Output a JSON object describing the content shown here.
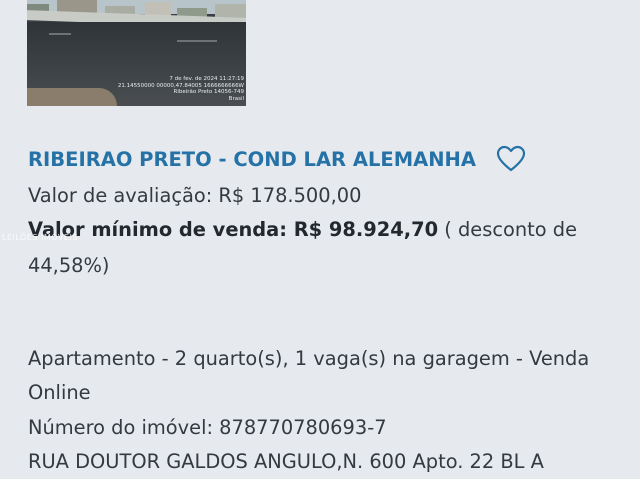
{
  "listing": {
    "photo": {
      "stamp_lines": [
        "7 de fev. de 2024 11:27:19",
        "21.14550000 00000,47.84005 1666666666W",
        "Ribeirão Preto 14056-749",
        "Brasil"
      ]
    },
    "title": "RIBEIRAO PRETO - COND LAR ALEMANHA",
    "favorite_icon": "heart-outline-icon",
    "valuation_label": "Valor de avaliação: R$ 178.500,00",
    "min_sale_label": "Valor mínimo de venda: R$ 98.924,70",
    "discount_part1": " ( desconto de",
    "discount_part2": "44,58%)",
    "description_line1": "Apartamento - 2 quarto(s), 1 vaga(s) na garagem - Venda",
    "description_line2": "Online",
    "property_number": "Número do imóvel: 878770780693-7",
    "address": "RUA DOUTOR GALDOS ANGULO,N. 600 Apto. 22 BL A"
  },
  "watermark": "LEILÕES IMÓVEIS",
  "colors": {
    "background": "#e6e9ed",
    "title": "#2572a6",
    "text": "#333a40"
  }
}
